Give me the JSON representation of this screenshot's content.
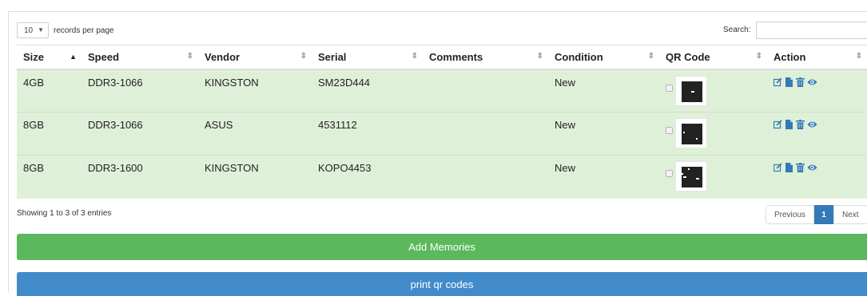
{
  "length": {
    "value": "10",
    "label": "records per page"
  },
  "search": {
    "label": "Search:",
    "value": ""
  },
  "table": {
    "columns": [
      "Size",
      "Speed",
      "Vendor",
      "Serial",
      "Comments",
      "Condition",
      "QR Code",
      "Action"
    ],
    "rows": [
      {
        "size": "4GB",
        "speed": "DDR3-1066",
        "vendor": "KINGSTON",
        "serial": "SM23D444",
        "comments": "",
        "condition": "New"
      },
      {
        "size": "8GB",
        "speed": "DDR3-1066",
        "vendor": "ASUS",
        "serial": "4531112",
        "comments": "",
        "condition": "New"
      },
      {
        "size": "8GB",
        "speed": "DDR3-1600",
        "vendor": "KINGSTON",
        "serial": "KOPO4453",
        "comments": "",
        "condition": "New"
      }
    ],
    "row_icons": [
      "edit-icon",
      "file-icon",
      "trash-icon",
      "eye-icon"
    ]
  },
  "info": "Showing 1 to 3 of 3 entries",
  "pagination": {
    "previous": "Previous",
    "current": "1",
    "next": "Next"
  },
  "buttons": {
    "add": "Add Memories",
    "print": "print qr codes"
  },
  "colors": {
    "row_bg": "#dff0d8",
    "add_button": "#5cb85c",
    "print_button": "#428bca",
    "action_icon": "#337ab7",
    "active_page": "#337ab7"
  }
}
